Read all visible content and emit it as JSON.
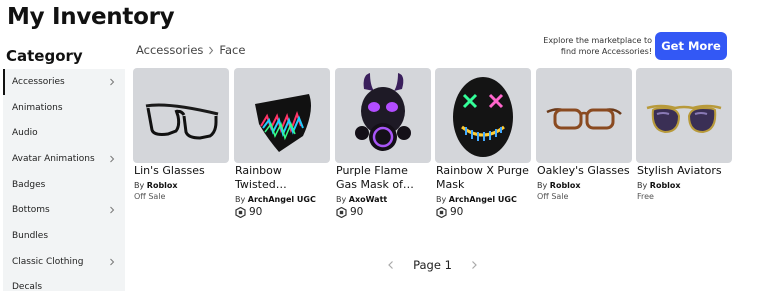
{
  "title": "My Inventory",
  "sidebar": {
    "heading": "Category",
    "items": [
      {
        "label": "Accessories",
        "has_arrow": true,
        "active": true
      },
      {
        "label": "Animations",
        "has_arrow": false
      },
      {
        "label": "Audio",
        "has_arrow": false
      },
      {
        "label": "Avatar Animations",
        "has_arrow": true
      },
      {
        "label": "Badges",
        "has_arrow": false
      },
      {
        "label": "Bottoms",
        "has_arrow": true
      },
      {
        "label": "Bundles",
        "has_arrow": false
      },
      {
        "label": "Classic Clothing",
        "has_arrow": true
      },
      {
        "label": "Decals",
        "has_arrow": false
      }
    ]
  },
  "breadcrumb": {
    "root": "Accessories",
    "current": "Face"
  },
  "promo": {
    "text": "Explore the marketplace to find more Accessories!",
    "button": "Get More"
  },
  "items": [
    {
      "name": "Lin's Glasses",
      "by": "By",
      "creator": "Roblox",
      "status": "Off Sale",
      "icon": "black-glasses-icon"
    },
    {
      "name": "Rainbow Twisted…",
      "by": "By",
      "creator": "ArchAngel UGC",
      "price": "90",
      "icon": "rainbow-mask-icon"
    },
    {
      "name": "Purple Flame Gas Mask of…",
      "by": "By",
      "creator": "AxoWatt",
      "price": "90",
      "icon": "gas-mask-icon"
    },
    {
      "name": "Rainbow X Purge Mask",
      "by": "By",
      "creator": "ArchAngel UGC",
      "price": "90",
      "icon": "purge-mask-icon"
    },
    {
      "name": "Oakley's Glasses",
      "by": "By",
      "creator": "Roblox",
      "status": "Off Sale",
      "icon": "brown-glasses-icon"
    },
    {
      "name": "Stylish Aviators",
      "by": "By",
      "creator": "Roblox",
      "status": "Free",
      "icon": "aviators-icon"
    }
  ],
  "pager": {
    "label": "Page 1"
  },
  "colors": {
    "accent": "#3358f5",
    "thumb_bg": "#d4d6da",
    "sidebar_bg": "#f2f4f5"
  }
}
